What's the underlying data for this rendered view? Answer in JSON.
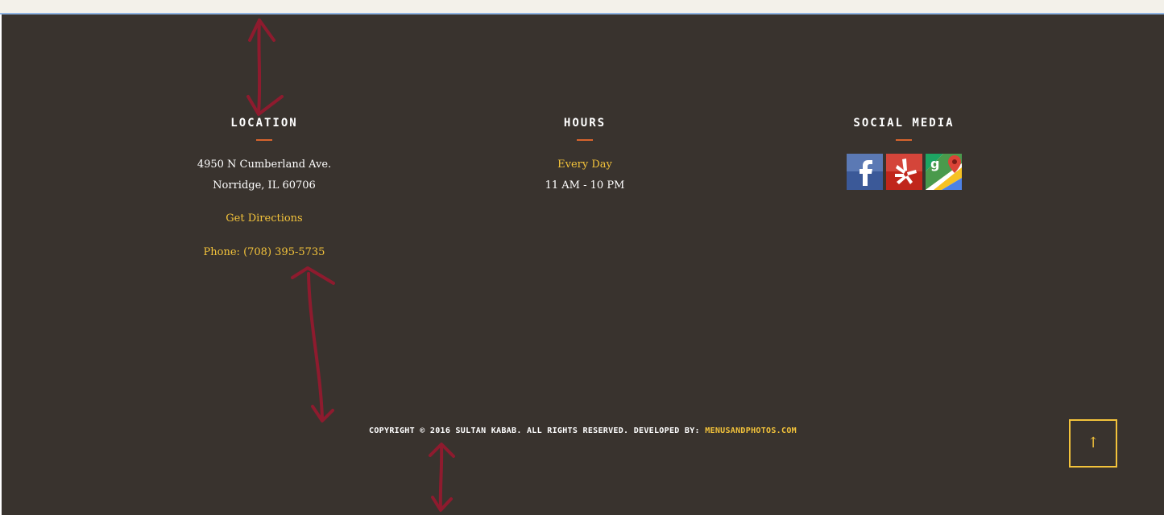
{
  "location": {
    "heading": "LOCATION",
    "address_line1": "4950 N Cumberland Ave.",
    "address_line2": "Norridge, IL 60706",
    "directions_link": "Get Directions",
    "phone_link": "Phone: (708) 395-5735"
  },
  "hours": {
    "heading": "HOURS",
    "days": "Every Day",
    "time": "11 AM - 10 PM"
  },
  "social": {
    "heading": "SOCIAL MEDIA",
    "icons": [
      "facebook-icon",
      "yelp-icon",
      "google-maps-icon"
    ]
  },
  "footer": {
    "copyright_text": "COPYRIGHT © 2016 SULTAN KABAB. ALL RIGHTS RESERVED. DEVELOPED BY: ",
    "developer_link": "MENUSANDPHOTOS.COM",
    "to_top_glyph": "↑"
  },
  "colors": {
    "background": "#39332e",
    "accent": "#f3c33b",
    "divider": "#d8642d",
    "annotation": "#8e1b2e"
  }
}
